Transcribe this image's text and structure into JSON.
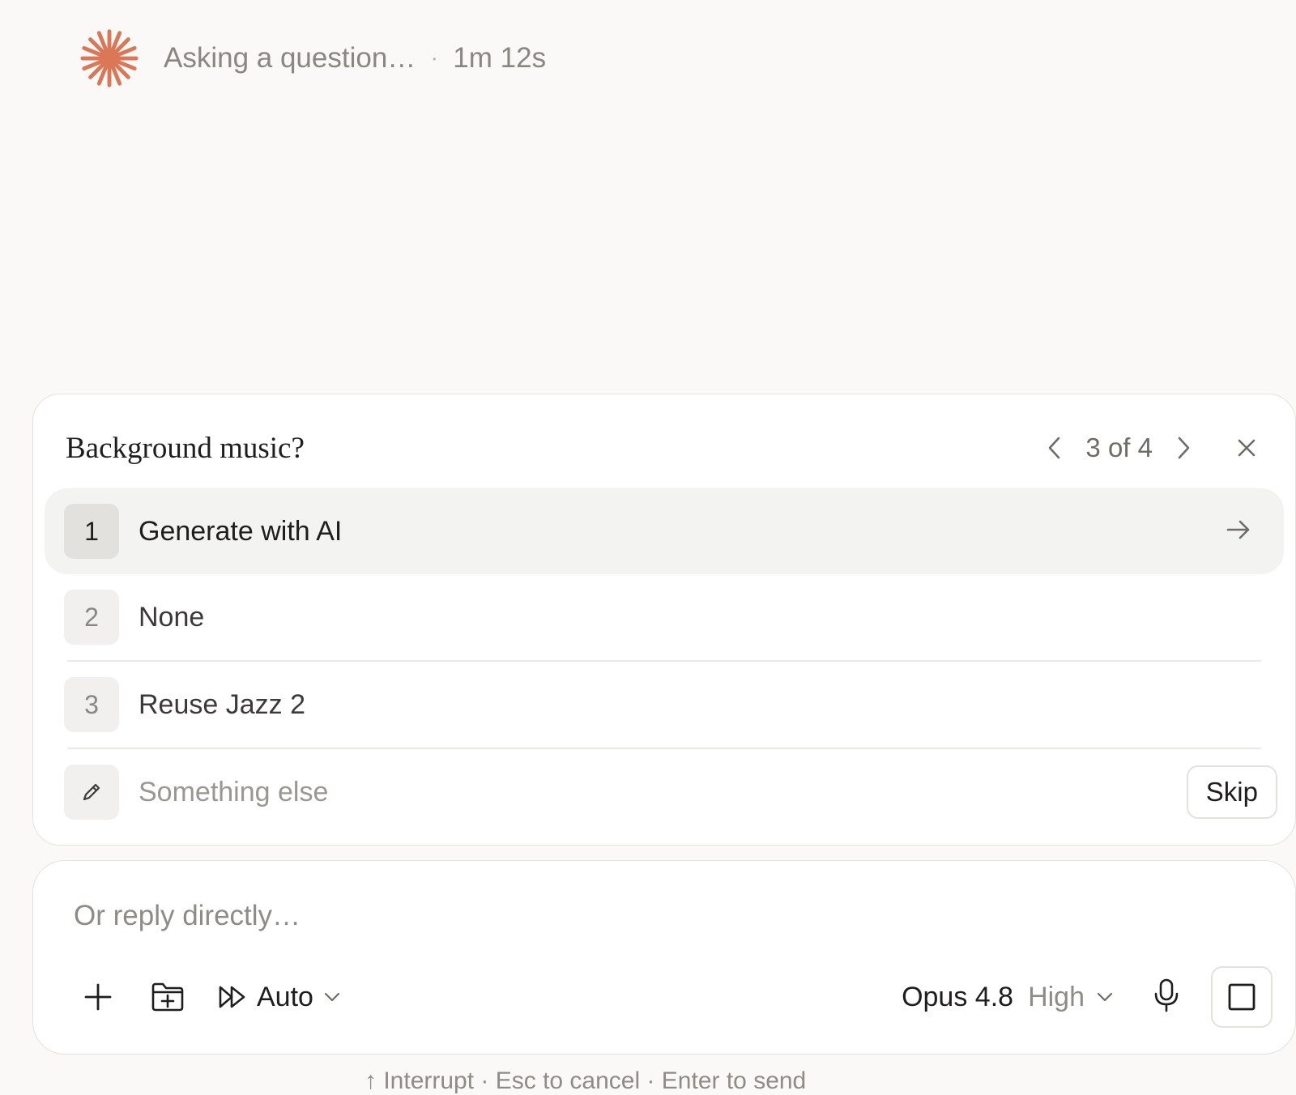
{
  "status": {
    "text": "Asking a question…",
    "separator": "·",
    "elapsed": "1m 12s",
    "icon": "spark-icon",
    "accent_color": "#d97757"
  },
  "question": {
    "title": "Background music?",
    "pager": "3 of 4",
    "options": [
      {
        "num": "1",
        "label": "Generate with AI"
      },
      {
        "num": "2",
        "label": "None"
      },
      {
        "num": "3",
        "label": "Reuse Jazz 2"
      }
    ],
    "other_placeholder": "Something else",
    "skip_label": "Skip"
  },
  "composer": {
    "placeholder": "Or reply directly…",
    "mode_label": "Auto",
    "model_label": "Opus 4.8",
    "effort_label": "High"
  },
  "footer": {
    "hint": "↑ Interrupt · Esc to cancel · Enter to send"
  }
}
